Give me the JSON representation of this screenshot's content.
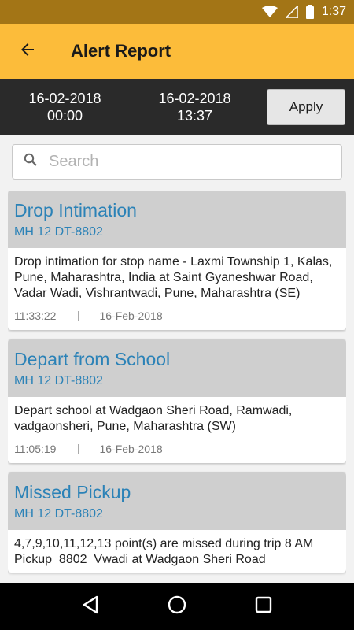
{
  "status_bar": {
    "time": "1:37",
    "icons": [
      "wifi-icon",
      "signal-icon",
      "battery-icon"
    ]
  },
  "app_bar": {
    "title": "Alert Report",
    "back_icon": "arrow-left-icon"
  },
  "filter": {
    "from_date": "16-02-2018",
    "from_time": "00:00",
    "to_date": "16-02-2018",
    "to_time": "13:37",
    "apply_label": "Apply"
  },
  "search": {
    "placeholder": "Search",
    "value": ""
  },
  "alerts": [
    {
      "title": "Drop Intimation",
      "plate": "MH 12 DT-8802",
      "description": "Drop intimation for stop name - Laxmi Township 1, Kalas, Pune, Maharashtra, India at Saint Gyaneshwar Road, Vadar Wadi, Vishrantwadi, Pune, Maharashtra (SE)",
      "time": "11:33:22",
      "date": "16-Feb-2018"
    },
    {
      "title": "Depart from School",
      "plate": "MH 12 DT-8802",
      "description": "Depart school at Wadgaon Sheri Road, Ramwadi, vadgaonsheri, Pune, Maharashtra (SW)",
      "time": "11:05:19",
      "date": "16-Feb-2018"
    },
    {
      "title": "Missed Pickup",
      "plate": "MH 12 DT-8802",
      "description": "4,7,9,10,11,12,13 point(s) are missed during trip 8 AM Pickup_8802_Vwadi at Wadgaon Sheri Road",
      "time": "",
      "date": ""
    }
  ],
  "nav_bar": {
    "icons": [
      "back-triangle-icon",
      "home-circle-icon",
      "recents-square-icon"
    ]
  },
  "colors": {
    "status_bar": "#a37516",
    "app_bar": "#fcbc3a",
    "filter_bar": "#2a2a2a",
    "accent_text": "#2b82b7"
  }
}
